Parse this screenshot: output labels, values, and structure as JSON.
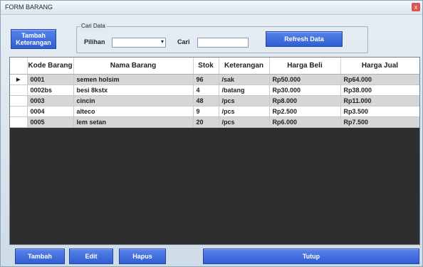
{
  "window": {
    "title": "FORM BARANG",
    "close_glyph": "x"
  },
  "top_button": {
    "line1": "Tambah",
    "line2": "Keterangan"
  },
  "search": {
    "group_label": "Cari Data",
    "pilihan_label": "Pilihan",
    "pilihan_value": "",
    "cari_label": "Cari",
    "cari_value": "",
    "refresh_label": "Refresh Data"
  },
  "table": {
    "columns": [
      "Kode Barang",
      "Nama Barang",
      "Stok",
      "Keterangan",
      "Harga Beli",
      "Harga Jual"
    ],
    "current_row_marker": "▶",
    "rows": [
      [
        "0001",
        "semen holsim",
        "96",
        "/sak",
        "Rp50.000",
        "Rp64.000"
      ],
      [
        "0002bs",
        "besi 8kstx",
        "4",
        "/batang",
        "Rp30.000",
        "Rp38.000"
      ],
      [
        "0003",
        "cincin",
        "48",
        "/pcs",
        "Rp8.000",
        "Rp11.000"
      ],
      [
        "0004",
        "alteco",
        "9",
        "/pcs",
        "Rp2.500",
        "Rp3.500"
      ],
      [
        "0005",
        "lem setan",
        "20",
        "/pcs",
        "Rp6.000",
        "Rp7.500"
      ]
    ]
  },
  "bottom_buttons": {
    "tambah": "Tambah",
    "edit": "Edit",
    "hapus": "Hapus",
    "tutup": "Tutup"
  },
  "colors": {
    "button": "#2f5fd6",
    "grid_background": "#2e2e2e",
    "row_alt": "#d6d6d6"
  }
}
